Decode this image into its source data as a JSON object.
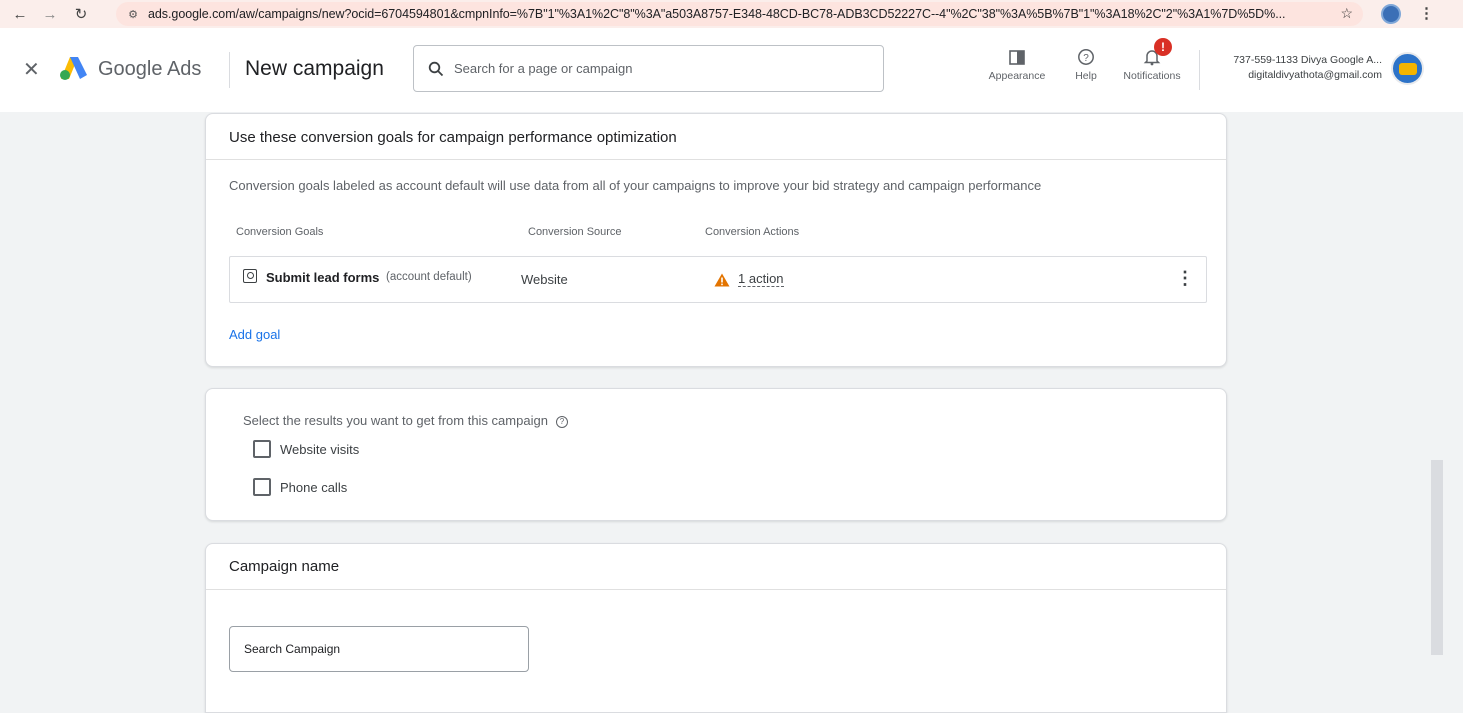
{
  "browser": {
    "url": "ads.google.com/aw/campaigns/new?ocid=6704594801&cmpnInfo=%7B\"1\"%3A1%2C\"8\"%3A\"a503A8757-E348-48CD-BC78-ADB3CD52227C--4\"%2C\"38\"%3A%5B%7B\"1\"%3A18%2C\"2\"%3A1%7D%5D%..."
  },
  "header": {
    "brand": "Google Ads",
    "page_title": "New campaign",
    "search_placeholder": "Search for a page or campaign",
    "tools": {
      "appearance": "Appearance",
      "help": "Help",
      "notifications": "Notifications",
      "notification_badge": "!"
    },
    "account": {
      "line1": "737-559-1133 Divya Google A...",
      "line2": "digitaldivyathota@gmail.com"
    }
  },
  "conversion_card": {
    "title": "Use these conversion goals for campaign performance optimization",
    "description": "Conversion goals labeled as account default will use data from all of your campaigns to improve your bid strategy and campaign performance",
    "columns": [
      "Conversion Goals",
      "Conversion Source",
      "Conversion Actions"
    ],
    "goal": {
      "name": "Submit lead forms",
      "tag": "(account default)",
      "source": "Website",
      "actions": "1 action"
    },
    "add_goal": "Add goal"
  },
  "results_card": {
    "label": "Select the results you want to get from this campaign",
    "help_glyph": "?",
    "options": [
      {
        "label": "Website visits",
        "checked": false
      },
      {
        "label": "Phone calls",
        "checked": false
      }
    ]
  },
  "campaign_name_card": {
    "title": "Campaign name",
    "value": "Search Campaign"
  },
  "colors": {
    "accent": "#1a73e8",
    "warning": "#e37400",
    "alert": "#d93025"
  }
}
